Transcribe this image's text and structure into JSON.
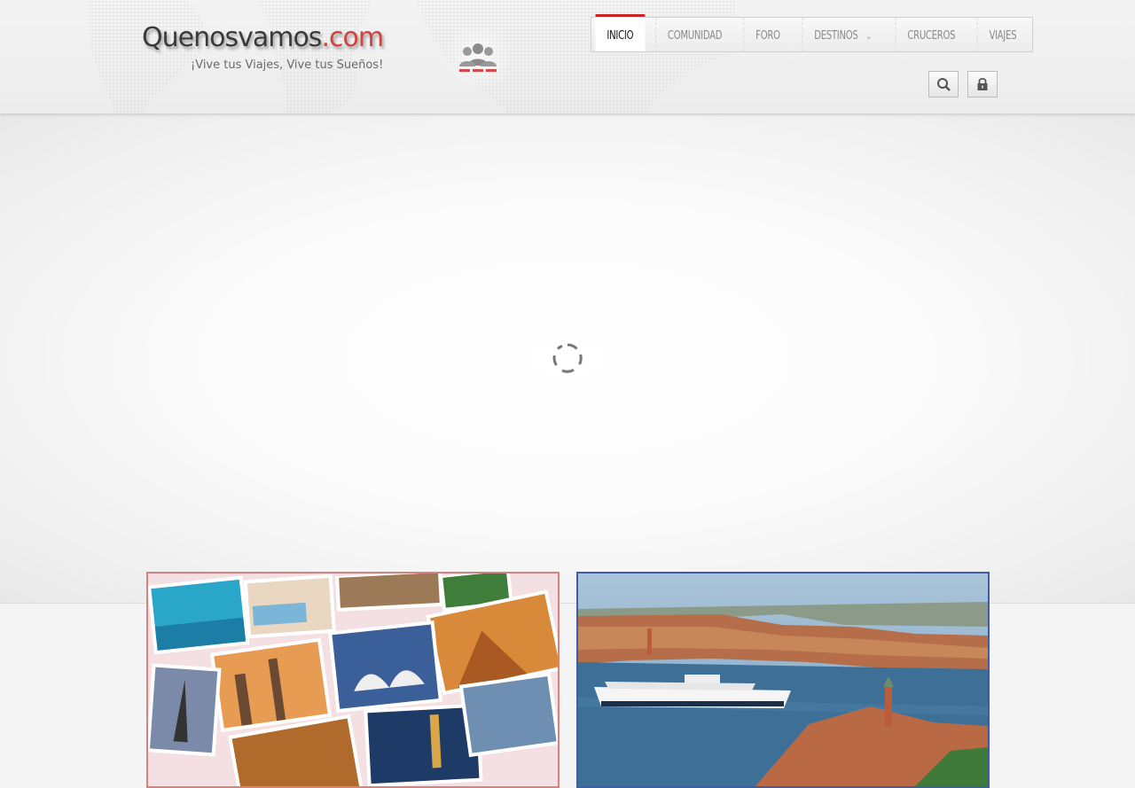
{
  "site": {
    "logo_main": "Quenosvamos",
    "logo_tld": ".com",
    "tagline": "¡Vive tus Viajes, Vive tus Sueños!"
  },
  "nav": {
    "items": [
      {
        "label": "INICIO",
        "active": true
      },
      {
        "label": "COMUNIDAD"
      },
      {
        "label": "FORO"
      },
      {
        "label": "DESTINOS",
        "has_submenu": true
      },
      {
        "label": "CRUCEROS"
      },
      {
        "label": "VIAJES"
      }
    ]
  },
  "toolbar": {
    "search_icon": "search-icon",
    "login_icon": "lock-icon"
  },
  "slider": {
    "state_icon": "loading-spinner-icon"
  },
  "features": [
    {
      "image": "travel-photo-collage"
    },
    {
      "image": "venice-cruise-aerial"
    }
  ],
  "colors": {
    "accent": "#cc2222",
    "logo_tld": "#d0423c",
    "text": "#8a8a8a",
    "left_card_border": "#d98080",
    "right_card_border": "#3e5da8"
  }
}
